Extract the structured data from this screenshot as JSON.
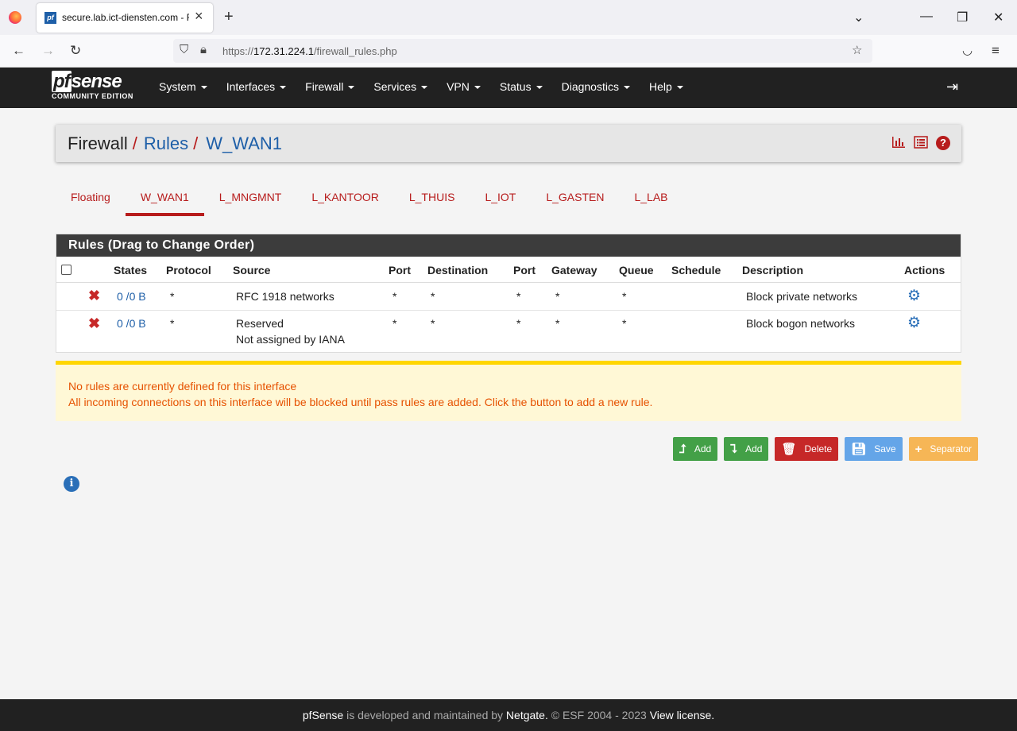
{
  "browser": {
    "tab_title": "secure.lab.ict-diensten.com - Fi",
    "favicon_text": "pf",
    "url_prefix": "https://",
    "url_host": "172.31.224.1",
    "url_path": "/firewall_rules.php"
  },
  "brand": {
    "logo_main": "sense",
    "logo_pf": "pf",
    "logo_sub": "COMMUNITY EDITION"
  },
  "menu": [
    "System",
    "Interfaces",
    "Firewall",
    "Services",
    "VPN",
    "Status",
    "Diagnostics",
    "Help"
  ],
  "breadcrumb": {
    "a": "Firewall",
    "sep": "/",
    "b": "Rules",
    "c": "W_WAN1"
  },
  "interface_tabs": [
    {
      "label": "Floating",
      "active": false
    },
    {
      "label": "W_WAN1",
      "active": true
    },
    {
      "label": "L_MNGMNT",
      "active": false
    },
    {
      "label": "L_KANTOOR",
      "active": false
    },
    {
      "label": "L_THUIS",
      "active": false
    },
    {
      "label": "L_IOT",
      "active": false
    },
    {
      "label": "L_GASTEN",
      "active": false
    },
    {
      "label": "L_LAB",
      "active": false
    }
  ],
  "rules": {
    "title": "Rules (Drag to Change Order)",
    "columns": {
      "states": "States",
      "protocol": "Protocol",
      "source": "Source",
      "port": "Port",
      "destination": "Destination",
      "port2": "Port",
      "gateway": "Gateway",
      "queue": "Queue",
      "schedule": "Schedule",
      "description": "Description",
      "actions": "Actions"
    },
    "rows": [
      {
        "states": "0 /0 B",
        "protocol": "*",
        "source": "RFC 1918 networks",
        "source2": "",
        "port": "*",
        "destination": "*",
        "port2": "*",
        "gateway": "*",
        "queue": "*",
        "schedule": "",
        "description": "Block private networks"
      },
      {
        "states": "0 /0 B",
        "protocol": "*",
        "source": "Reserved",
        "source2": "Not assigned by IANA",
        "port": "*",
        "destination": "*",
        "port2": "*",
        "gateway": "*",
        "queue": "*",
        "schedule": "",
        "description": "Block bogon networks"
      }
    ]
  },
  "alert": {
    "line1": "No rules are currently defined for this interface",
    "line2": "All incoming connections on this interface will be blocked until pass rules are added. Click the button to add a new rule."
  },
  "buttons": {
    "add_top": "Add",
    "add_bottom": "Add",
    "delete": "Delete",
    "save": "Save",
    "separator": "Separator"
  },
  "footer": {
    "brand": "pfSense",
    "text1": "is developed and maintained by",
    "netgate": "Netgate.",
    "text2": "© ESF 2004 - 2023",
    "license": "View license."
  },
  "colors": {
    "header_bg": "#212121",
    "accent_red": "#b71c1c",
    "link_blue": "#1e5fa8",
    "alert_bg": "#fff8d6",
    "alert_text": "#e65100"
  }
}
